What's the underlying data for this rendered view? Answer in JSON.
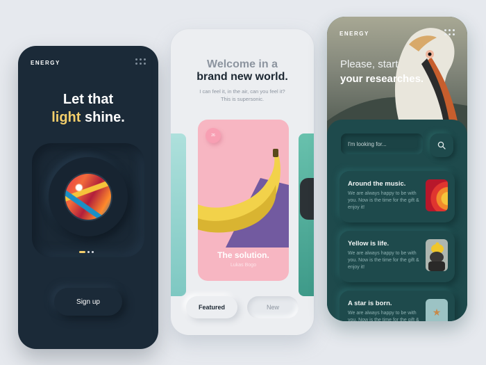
{
  "phone1": {
    "brand": "ENERGY",
    "headline_line1": "Let that",
    "headline_accent": "light",
    "headline_rest": " shine.",
    "signup_label": "Sign up",
    "accent_color": "#f4cf6b"
  },
  "phone2": {
    "welcome_line1": "Welcome in a",
    "welcome_line2": "brand new world.",
    "subtitle_line1": "I can feel it, in the air, can you feel it?",
    "subtitle_line2": "This is supersonic.",
    "card": {
      "badge": "26",
      "title": "The solution.",
      "author": "Lukas Bogo"
    },
    "tabs": {
      "featured": "Featured",
      "new": "New"
    }
  },
  "phone3": {
    "brand": "ENERGY",
    "heading_line1": "Please, start",
    "heading_line2": "your researches.",
    "search_placeholder": "I'm looking for...",
    "items": [
      {
        "title": "Around the music.",
        "desc": "We are always happy to be with you. Now is the time for the gift & enjoy it!",
        "thumb": "music-art"
      },
      {
        "title": "Yellow is life.",
        "desc": "We are always happy to be with you. Now is the time for the gift & enjoy it!",
        "thumb": "yellow-hat-photo"
      },
      {
        "title": "A star is born.",
        "desc": "We are always happy to be with you. Now is the time for the gift & enjoy it!",
        "thumb": "star-photo"
      }
    ]
  }
}
